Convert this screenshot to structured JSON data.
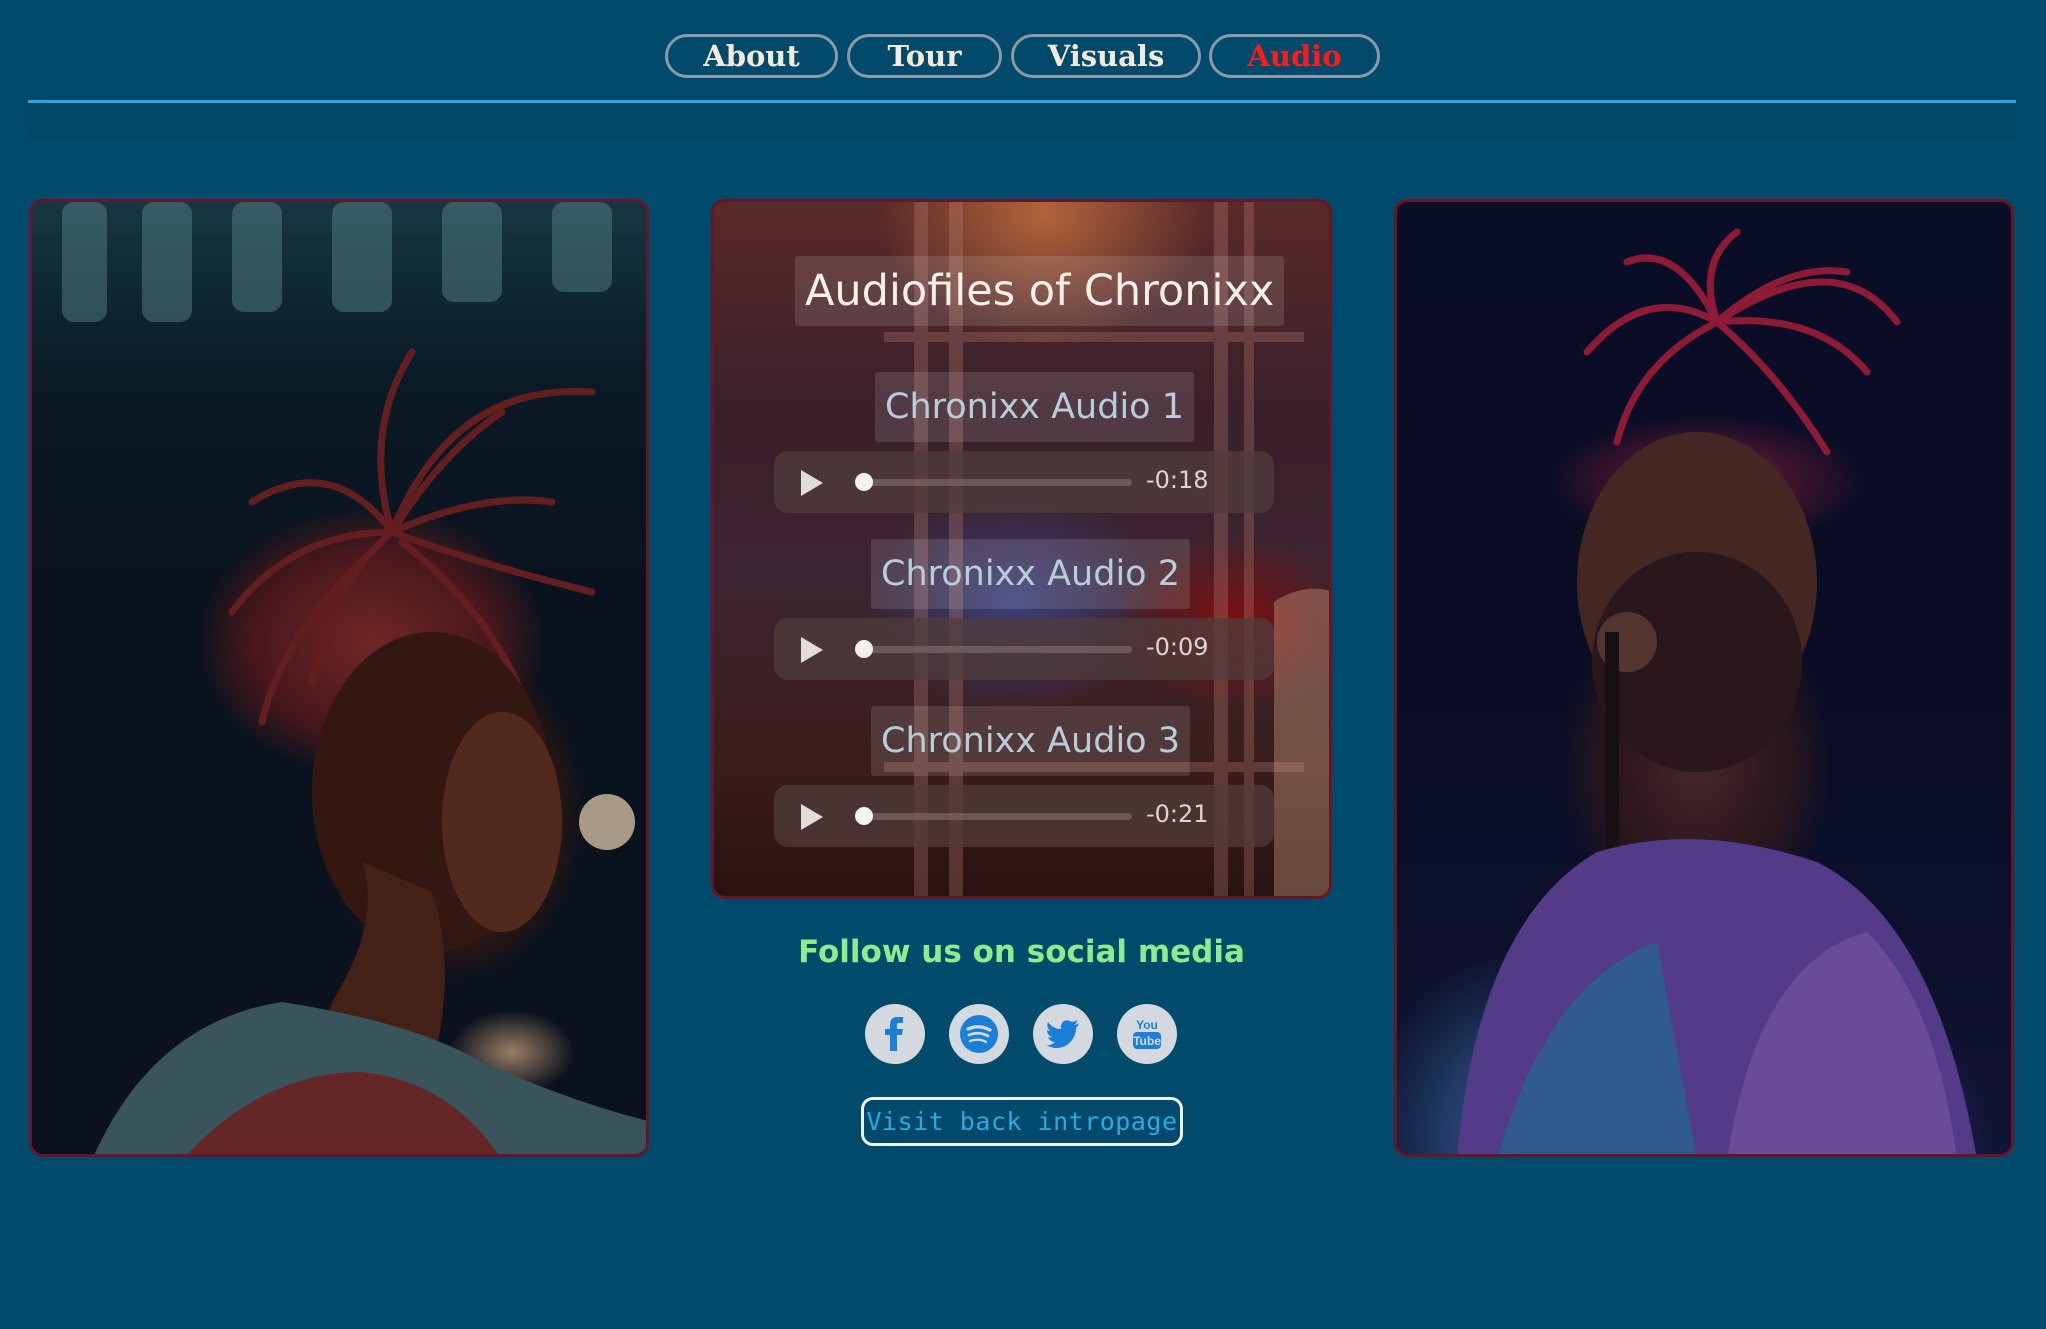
{
  "nav": {
    "items": [
      {
        "label": "About",
        "active": false
      },
      {
        "label": "Tour",
        "active": false
      },
      {
        "label": "Visuals",
        "active": false
      },
      {
        "label": "Audio",
        "active": true
      }
    ],
    "active_color": "#ff1a1a"
  },
  "audio": {
    "title": "Audiofiles of Chronixx",
    "tracks": [
      {
        "label": "Chronixx Audio 1",
        "time": "-0:18"
      },
      {
        "label": "Chronixx Audio 2",
        "time": "-0:09"
      },
      {
        "label": "Chronixx Audio 3",
        "time": "-0:21"
      }
    ]
  },
  "social": {
    "heading": "Follow us on social media",
    "icons": [
      "facebook-icon",
      "spotify-icon",
      "twitter-icon",
      "youtube-icon"
    ]
  },
  "cta": {
    "label": "Visit back intropage"
  },
  "colors": {
    "background": "#014a6b",
    "accent_line": "#2aa4dc",
    "follow_text": "#8cee8a",
    "panel_border": "#6a1426"
  }
}
